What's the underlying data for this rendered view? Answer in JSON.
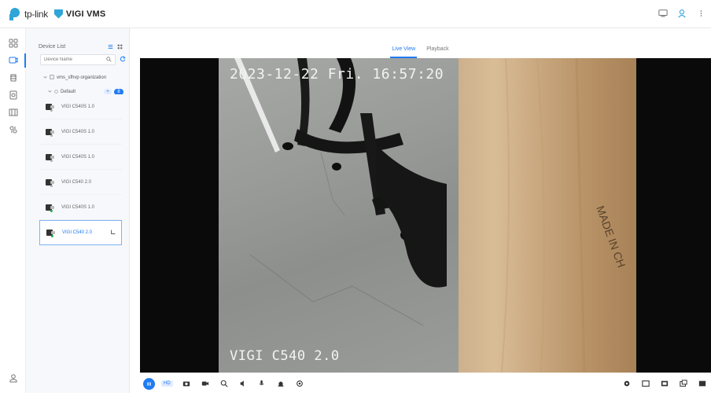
{
  "brand": {
    "tplink": "tp-link",
    "vigi": "VIGI VMS"
  },
  "top_icons": [
    "monitor-icon",
    "user-icon",
    "more-icon"
  ],
  "rail": [
    {
      "name": "dashboard-icon",
      "active": false
    },
    {
      "name": "device-icon",
      "active": true
    },
    {
      "name": "event-icon",
      "active": false
    },
    {
      "name": "map-icon",
      "active": false
    },
    {
      "name": "storage-icon",
      "active": false
    },
    {
      "name": "settings-icon",
      "active": false
    }
  ],
  "device_panel": {
    "title": "Device List",
    "search_placeholder": "Device Name",
    "org_label": "vms_sfhvp organization",
    "group_label": "Default",
    "group_badge": "8",
    "devices": [
      {
        "label": "VIGI C540S 1.0",
        "online": false,
        "selected": false
      },
      {
        "label": "VIGI C540S 1.0",
        "online": false,
        "selected": false
      },
      {
        "label": "VIGI C540S 1.0",
        "online": false,
        "selected": false
      },
      {
        "label": "VIGI C540 2.0",
        "online": false,
        "selected": false
      },
      {
        "label": "VIGI C540S 1.0",
        "online": true,
        "selected": false
      },
      {
        "label": "VIGI C540 2.0",
        "online": true,
        "selected": true
      }
    ]
  },
  "tabs": {
    "live": "Live View",
    "playback": "Playback"
  },
  "video": {
    "timestamp": "2023-12-22 Fri. 16:57:20",
    "camera_name": "VIGI C540 2.0"
  },
  "controls": {
    "quality": "HD",
    "left_icons": [
      "snapshot-icon",
      "record-icon",
      "zoom-icon",
      "audio-icon",
      "talk-icon",
      "alarm-icon",
      "ptz-icon"
    ],
    "right_icons": [
      "settings-icon",
      "layout-icon",
      "window-icon",
      "multi-window-icon",
      "fullscreen-icon"
    ]
  }
}
